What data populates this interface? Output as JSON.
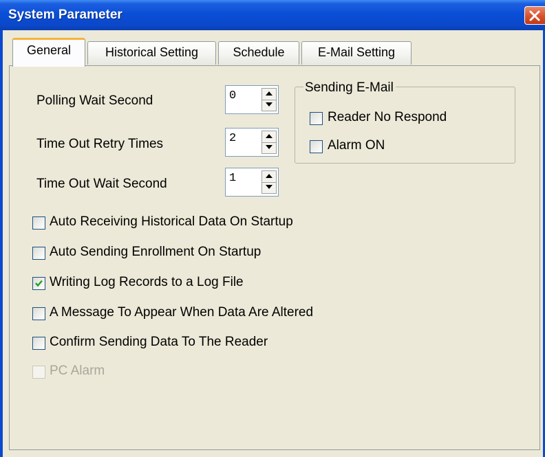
{
  "window": {
    "title": "System Parameter"
  },
  "tabs": [
    {
      "label": "General",
      "active": true
    },
    {
      "label": "Historical Setting",
      "active": false
    },
    {
      "label": "Schedule",
      "active": false
    },
    {
      "label": "E-Mail Setting",
      "active": false
    }
  ],
  "general": {
    "polling_wait_second": {
      "label": "Polling Wait Second",
      "value": "0"
    },
    "timeout_retry_times": {
      "label": "Time Out Retry Times",
      "value": "2"
    },
    "timeout_wait_second": {
      "label": "Time Out Wait Second",
      "value": "1"
    },
    "sending_email": {
      "title": "Sending E-Mail",
      "reader_no_respond": {
        "label": "Reader No Respond",
        "checked": false
      },
      "alarm_on": {
        "label": "Alarm ON",
        "checked": false
      }
    },
    "options": [
      {
        "label": "Auto Receiving Historical Data On Startup",
        "checked": false,
        "enabled": true
      },
      {
        "label": "Auto Sending Enrollment On Startup",
        "checked": false,
        "enabled": true
      },
      {
        "label": "Writing Log Records to a Log File",
        "checked": true,
        "enabled": true
      },
      {
        "label": "A Message To Appear When Data Are Altered",
        "checked": false,
        "enabled": true
      },
      {
        "label": "Confirm Sending Data To The Reader",
        "checked": false,
        "enabled": true
      },
      {
        "label": "PC Alarm",
        "checked": false,
        "enabled": false
      }
    ]
  },
  "icons": {
    "close": "close-icon",
    "spin_up": "arrow-up-icon",
    "spin_down": "arrow-down-icon",
    "check": "checkmark-icon"
  },
  "colors": {
    "titlebar": "#0a4fd8",
    "dialog_bg": "#ece9d8",
    "close_button": "#d8512c",
    "active_tab_accent": "#f6b33c",
    "checkmark": "#21a121"
  }
}
